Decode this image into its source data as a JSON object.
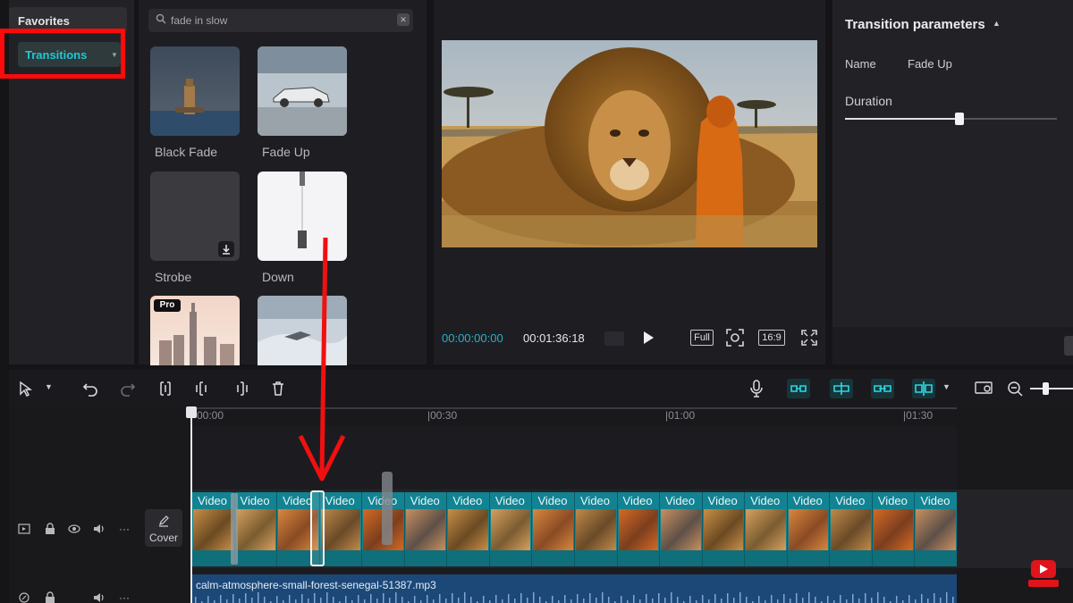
{
  "categories": {
    "favorites_label": "Favorites",
    "transitions_label": "Transitions"
  },
  "search": {
    "value": "fade in slow"
  },
  "transitions": [
    {
      "label": "Black Fade"
    },
    {
      "label": "Fade Up"
    },
    {
      "label": "Strobe"
    },
    {
      "label": "Down"
    },
    {
      "label": ""
    },
    {
      "label": ""
    }
  ],
  "pro_badge": "Pro",
  "preview": {
    "current_time": "00:00:00:00",
    "total_time": "00:01:36:18",
    "full_label": "Full",
    "ratio_label": "16:9"
  },
  "parameters": {
    "title": "Transition parameters",
    "name_label": "Name",
    "name_value": "Fade Up",
    "duration_label": "Duration",
    "duration_level": 0.54
  },
  "timeline": {
    "ruler": [
      "00:00",
      "|00:30",
      "|01:00",
      "|01:30"
    ],
    "cover_label": "Cover",
    "clip_label": "Video",
    "clip_count": 18,
    "audio_label": "calm-atmosphere-small-forest-senegal-51387.mp3"
  },
  "colors": {
    "accent": "#1fc7d4",
    "highlight": "#ff0a0a",
    "clip": "#128392",
    "audio": "#1c4878"
  }
}
